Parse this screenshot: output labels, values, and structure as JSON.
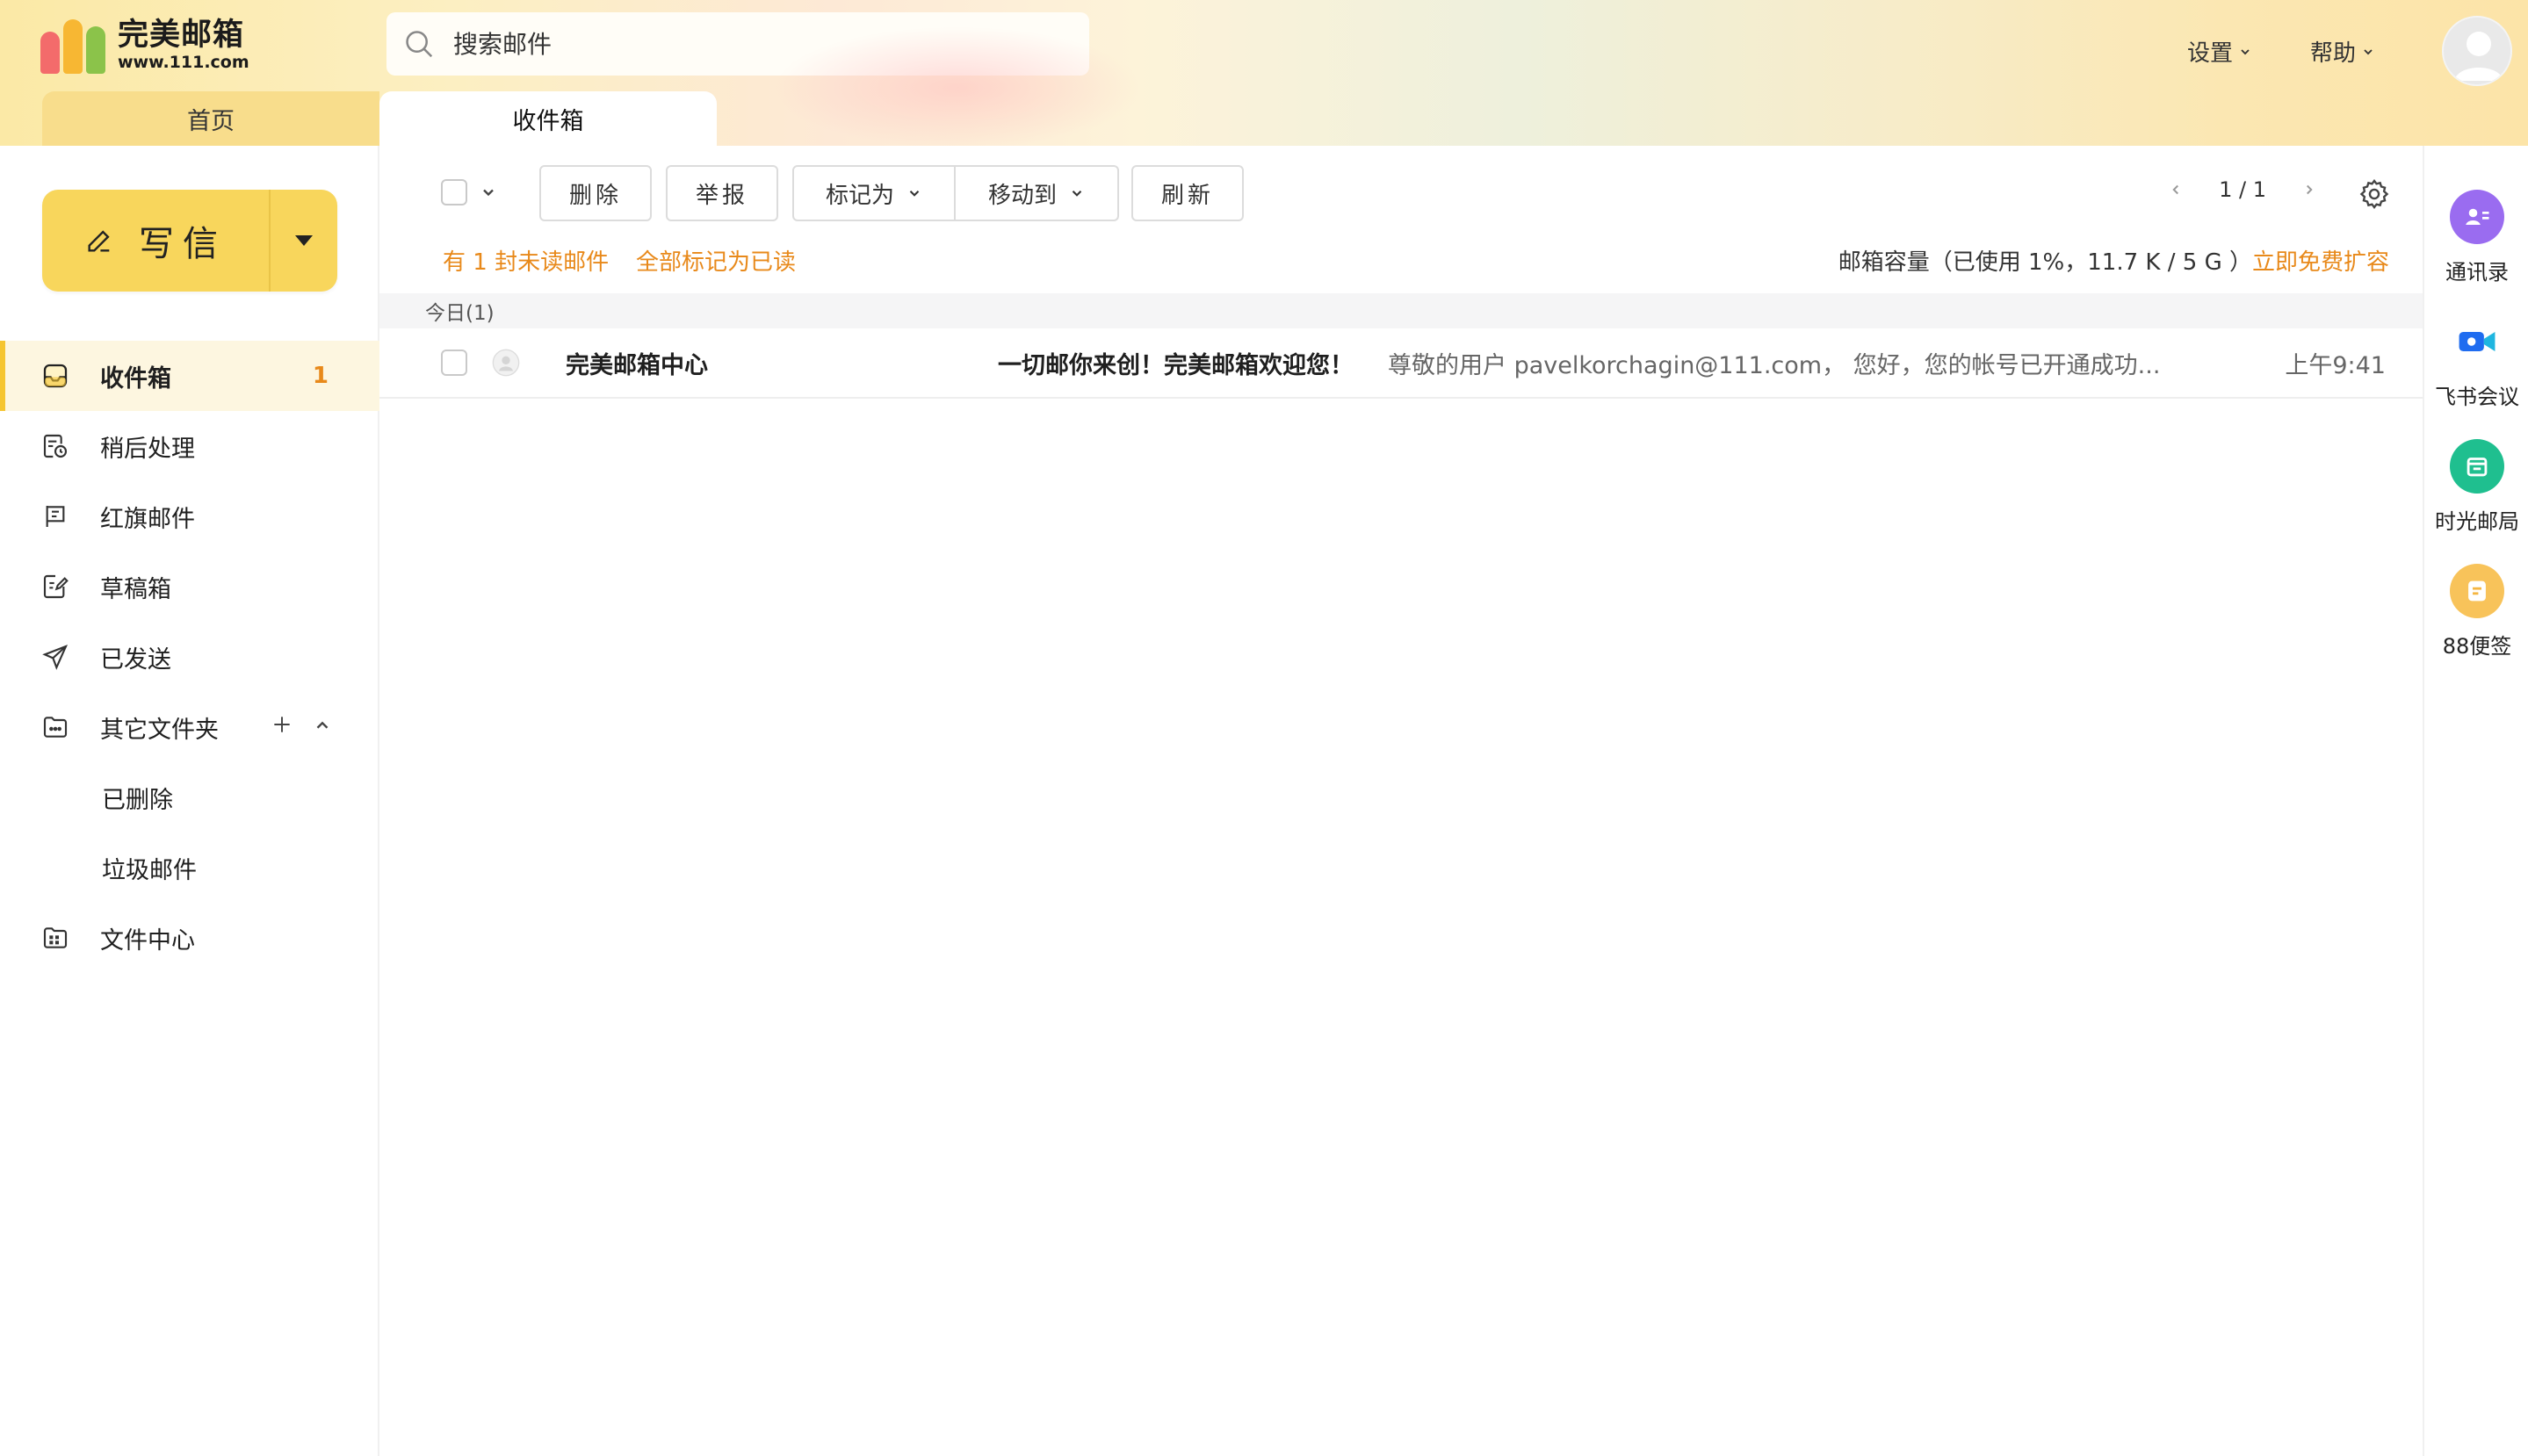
{
  "app": {
    "logo_title": "完美邮箱",
    "logo_domain": "www.111.com"
  },
  "search": {
    "placeholder": "搜索邮件"
  },
  "header": {
    "settings_label": "设置",
    "help_label": "帮助"
  },
  "tabs": [
    {
      "label": "首页"
    },
    {
      "label": "收件箱"
    }
  ],
  "compose": {
    "label": "写信"
  },
  "sidebar": {
    "items": [
      {
        "label": "收件箱",
        "icon": "inbox-icon",
        "badge": "1"
      },
      {
        "label": "稍后处理",
        "icon": "clock-doc-icon"
      },
      {
        "label": "红旗邮件",
        "icon": "flag-icon"
      },
      {
        "label": "草稿箱",
        "icon": "draft-icon"
      },
      {
        "label": "已发送",
        "icon": "send-icon"
      },
      {
        "label": "其它文件夹",
        "icon": "folder-icon"
      },
      {
        "label": "已删除"
      },
      {
        "label": "垃圾邮件"
      },
      {
        "label": "文件中心",
        "icon": "file-center-icon"
      }
    ]
  },
  "toolbar": {
    "delete_label": "删除",
    "report_label": "举报",
    "mark_as_label": "标记为",
    "move_to_label": "移动到",
    "refresh_label": "刷新",
    "page_indicator": "1 / 1"
  },
  "info": {
    "unread_text": "有 1 封未读邮件",
    "mark_all_read": "全部标记为已读",
    "capacity_text": "邮箱容量（已使用 1%，11.7 K / 5 G ）",
    "expand_link": "立即免费扩容"
  },
  "mail_list": {
    "group_label": "今日(1)",
    "rows": [
      {
        "sender": "完美邮箱中心",
        "subject": "一切邮你来创！完美邮箱欢迎您！",
        "preview": "尊敬的用户 pavelkorchagin@111.com， 您好，您的帐号已开通成功...",
        "time": "上午9:41"
      }
    ]
  },
  "right_apps": [
    {
      "label": "通讯录",
      "icon": "contacts-icon",
      "color": "#9a6cf0"
    },
    {
      "label": "飞书会议",
      "icon": "video-meeting-icon",
      "color": "#1f6cf0"
    },
    {
      "label": "时光邮局",
      "icon": "time-mailbox-icon",
      "color": "#1fbf8f"
    },
    {
      "label": "88便签",
      "icon": "note-icon",
      "color": "#f5b642"
    }
  ],
  "colors": {
    "accent": "#f8d65c",
    "orange": "#e8891a",
    "active_bg": "#fdf6e0"
  }
}
